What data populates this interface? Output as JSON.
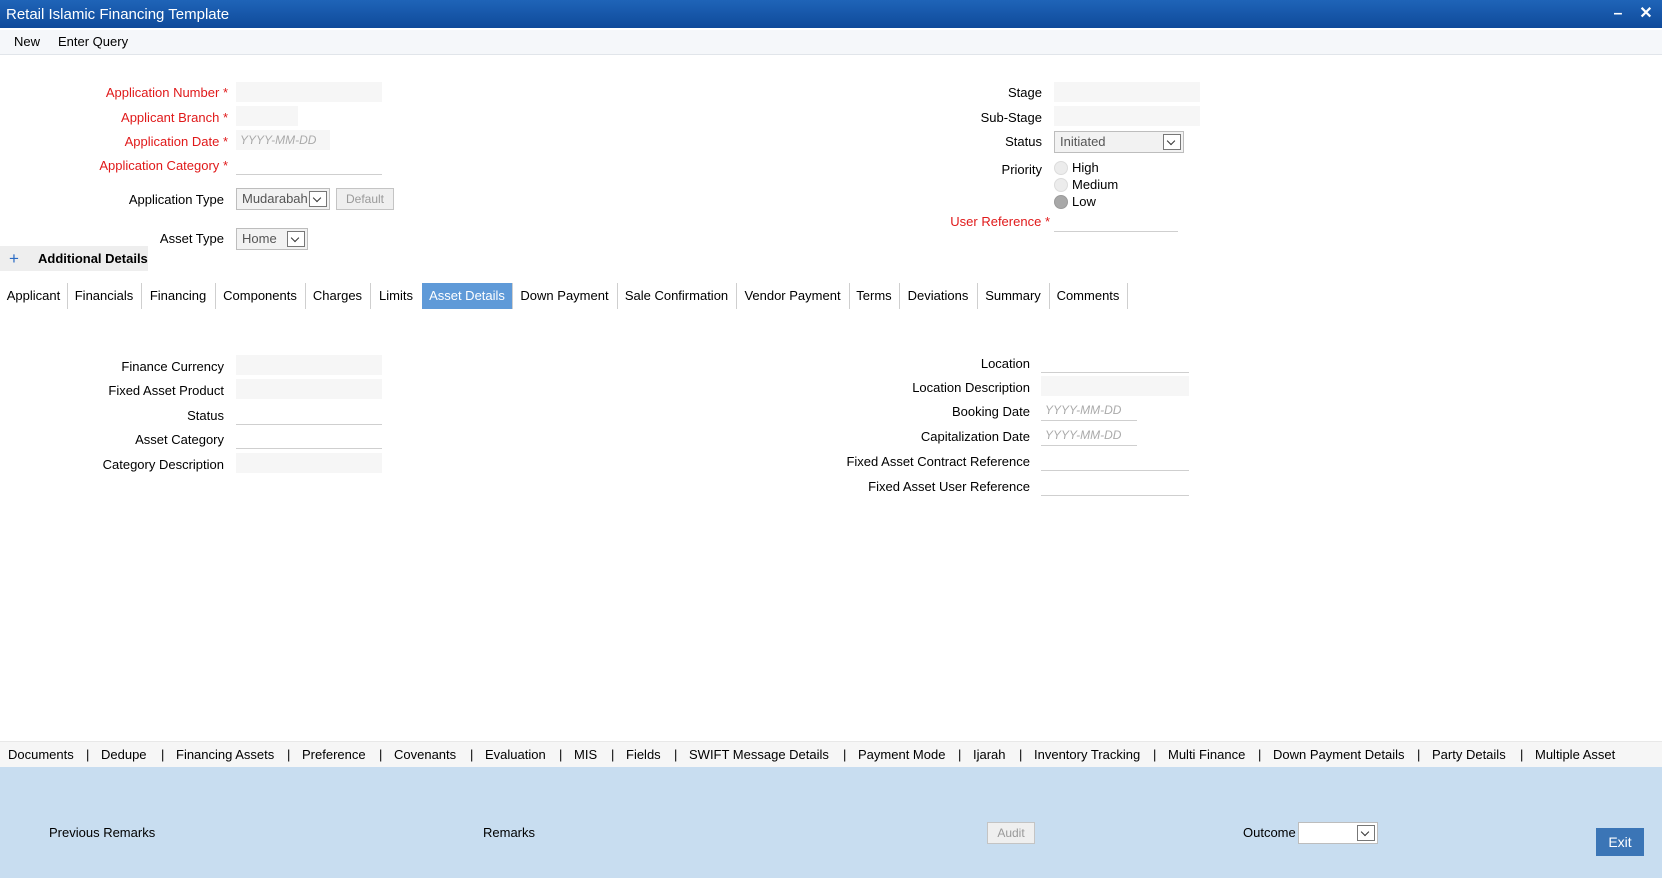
{
  "window": {
    "title": "Retail Islamic Financing Template"
  },
  "menu": {
    "new": "New",
    "enter_query": "Enter Query"
  },
  "header": {
    "application_number_label": "Application Number",
    "applicant_branch_label": "Applicant Branch",
    "application_date_label": "Application Date",
    "application_date_placeholder": "YYYY-MM-DD",
    "application_category_label": "Application Category",
    "application_type_label": "Application Type",
    "application_type_value": "Mudarabah",
    "default_button": "Default",
    "asset_type_label": "Asset Type",
    "asset_type_value": "Home",
    "stage_label": "Stage",
    "substage_label": "Sub-Stage",
    "status_label": "Status",
    "status_value": "Initiated",
    "priority_label": "Priority",
    "priority_options": [
      "High",
      "Medium",
      "Low"
    ],
    "priority_selected": "Low",
    "user_reference_label": "User Reference",
    "required_mark": "*"
  },
  "additional_details": {
    "plus": "+",
    "label": "Additional Details"
  },
  "tabs": [
    "Applicant",
    "Financials",
    "Financing",
    "Components",
    "Charges",
    "Limits",
    "Asset Details",
    "Down Payment",
    "Sale Confirmation",
    "Vendor Payment",
    "Terms",
    "Deviations",
    "Summary",
    "Comments"
  ],
  "active_tab": "Asset Details",
  "asset": {
    "finance_currency_label": "Finance Currency",
    "fixed_asset_product_label": "Fixed Asset Product",
    "status_label": "Status",
    "asset_category_label": "Asset Category",
    "category_description_label": "Category Description",
    "location_label": "Location",
    "location_description_label": "Location Description",
    "booking_date_label": "Booking Date",
    "capitalization_date_label": "Capitalization Date",
    "date_placeholder": "YYYY-MM-DD",
    "fixed_asset_contract_reference_label": "Fixed Asset Contract Reference",
    "fixed_asset_user_reference_label": "Fixed Asset User Reference"
  },
  "bottom_links": [
    "Documents",
    "Dedupe",
    "Financing Assets",
    "Preference",
    "Covenants",
    "Evaluation",
    "MIS",
    "Fields",
    "SWIFT Message Details",
    "Payment Mode",
    "Ijarah",
    "Inventory Tracking",
    "Multi Finance",
    "Down Payment Details",
    "Party Details",
    "Multiple Asset"
  ],
  "separator": "|",
  "footer": {
    "previous_remarks": "Previous Remarks",
    "remarks": "Remarks",
    "audit": "Audit",
    "outcome": "Outcome",
    "exit": "Exit"
  }
}
